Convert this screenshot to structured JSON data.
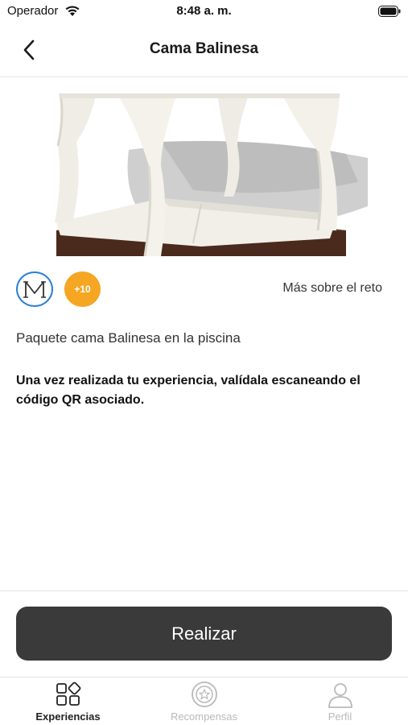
{
  "status_bar": {
    "carrier": "Operador",
    "time": "8:48 a. m."
  },
  "header": {
    "title": "Cama Balinesa",
    "back_icon": "chevron-left-icon"
  },
  "challenge": {
    "brand_icon": "monogram-m-icon",
    "points_badge": "+10",
    "more_link": "Más sobre el reto",
    "description": "Paquete cama Balinesa en la piscina",
    "instructions": "Una vez realizada tu experiencia, valídala escaneando el código QR asociado."
  },
  "action": {
    "label": "Realizar"
  },
  "tab_bar": {
    "tabs": [
      {
        "label": "Experiencias",
        "icon": "grid-shapes-icon",
        "active": true
      },
      {
        "label": "Recompensas",
        "icon": "coin-star-icon",
        "active": false
      },
      {
        "label": "Perfil",
        "icon": "user-icon",
        "active": false
      }
    ]
  },
  "colors": {
    "brand_blue": "#2b7fd6",
    "points_orange": "#f5a623",
    "button_dark": "#3a3a3a",
    "inactive_gray": "#b9b9b9"
  }
}
